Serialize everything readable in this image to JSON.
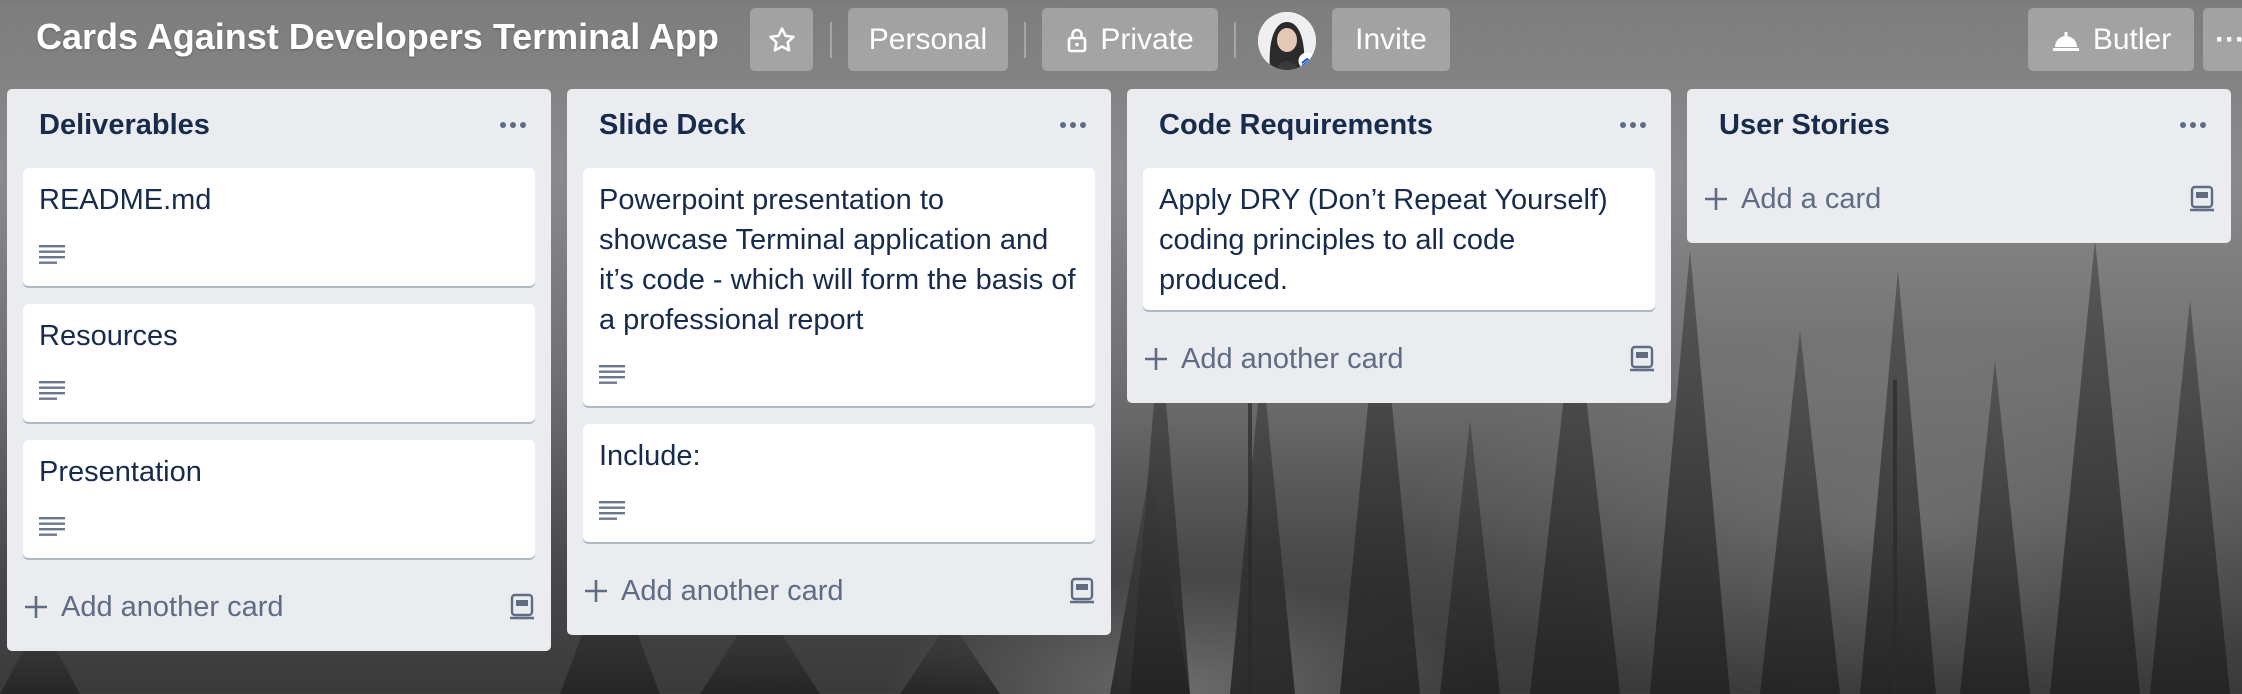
{
  "header": {
    "board_title": "Cards Against Developers Terminal App",
    "star_icon": "star-icon",
    "team_label": "Personal",
    "visibility_label": "Private",
    "lock_icon": "lock-icon",
    "invite_label": "Invite",
    "butler_label": "Butler",
    "butler_icon": "butler-bell-icon",
    "more_label": "···"
  },
  "lists": [
    {
      "title": "Deliverables",
      "cards": [
        "README.md",
        "Resources",
        "Presentation"
      ],
      "add_label": "Add another card"
    },
    {
      "title": "Slide Deck",
      "cards": [
        "Powerpoint presentation to showcase Terminal application and it’s code - which will form the basis of a professional report",
        "Include:"
      ],
      "add_label": "Add another card"
    },
    {
      "title": "Code Requirements",
      "cards": [
        "Apply DRY (Don’t Repeat Yourself) coding principles to all code produced."
      ],
      "add_label": "Add another card"
    },
    {
      "title": "User Stories",
      "cards": [],
      "add_label": "Add a card"
    }
  ],
  "colors": {
    "list_bg": "#ebecf0",
    "card_text": "#172b4d",
    "muted_text": "#5e6c84"
  }
}
